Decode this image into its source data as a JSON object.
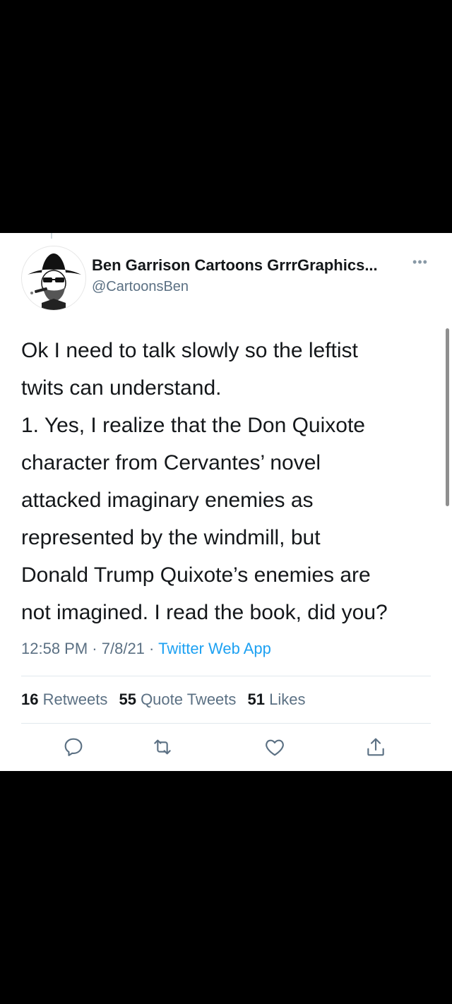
{
  "tweet": {
    "display_name": "Ben Garrison Cartoons GrrrGraphics...",
    "handle": "@CartoonsBen",
    "more_icon": "more-dots-icon",
    "text_lines": [
      "Ok I need to talk slowly so the leftist",
      "twits can understand.",
      "1. Yes, I realize that the Don Quixote",
      "character from Cervantes’ novel",
      "attacked imaginary enemies as",
      "represented by the windmill, but",
      "Donald Trump Quixote’s enemies are",
      "not imagined. I read the book, did you?"
    ],
    "time": "12:58 PM",
    "date": "7/8/21",
    "separator": "·",
    "source": "Twitter Web App",
    "stats": {
      "retweets_count": "16",
      "retweets_label": "Retweets",
      "quotes_count": "55",
      "quotes_label": "Quote Tweets",
      "likes_count": "51",
      "likes_label": "Likes"
    },
    "actions": [
      "reply-icon",
      "retweet-icon",
      "like-icon",
      "share-icon"
    ]
  },
  "colors": {
    "text_primary": "#14171a",
    "text_secondary": "#5b7083",
    "link": "#1da1f2",
    "divider": "#e1e8ed",
    "icon": "#5b7083"
  }
}
